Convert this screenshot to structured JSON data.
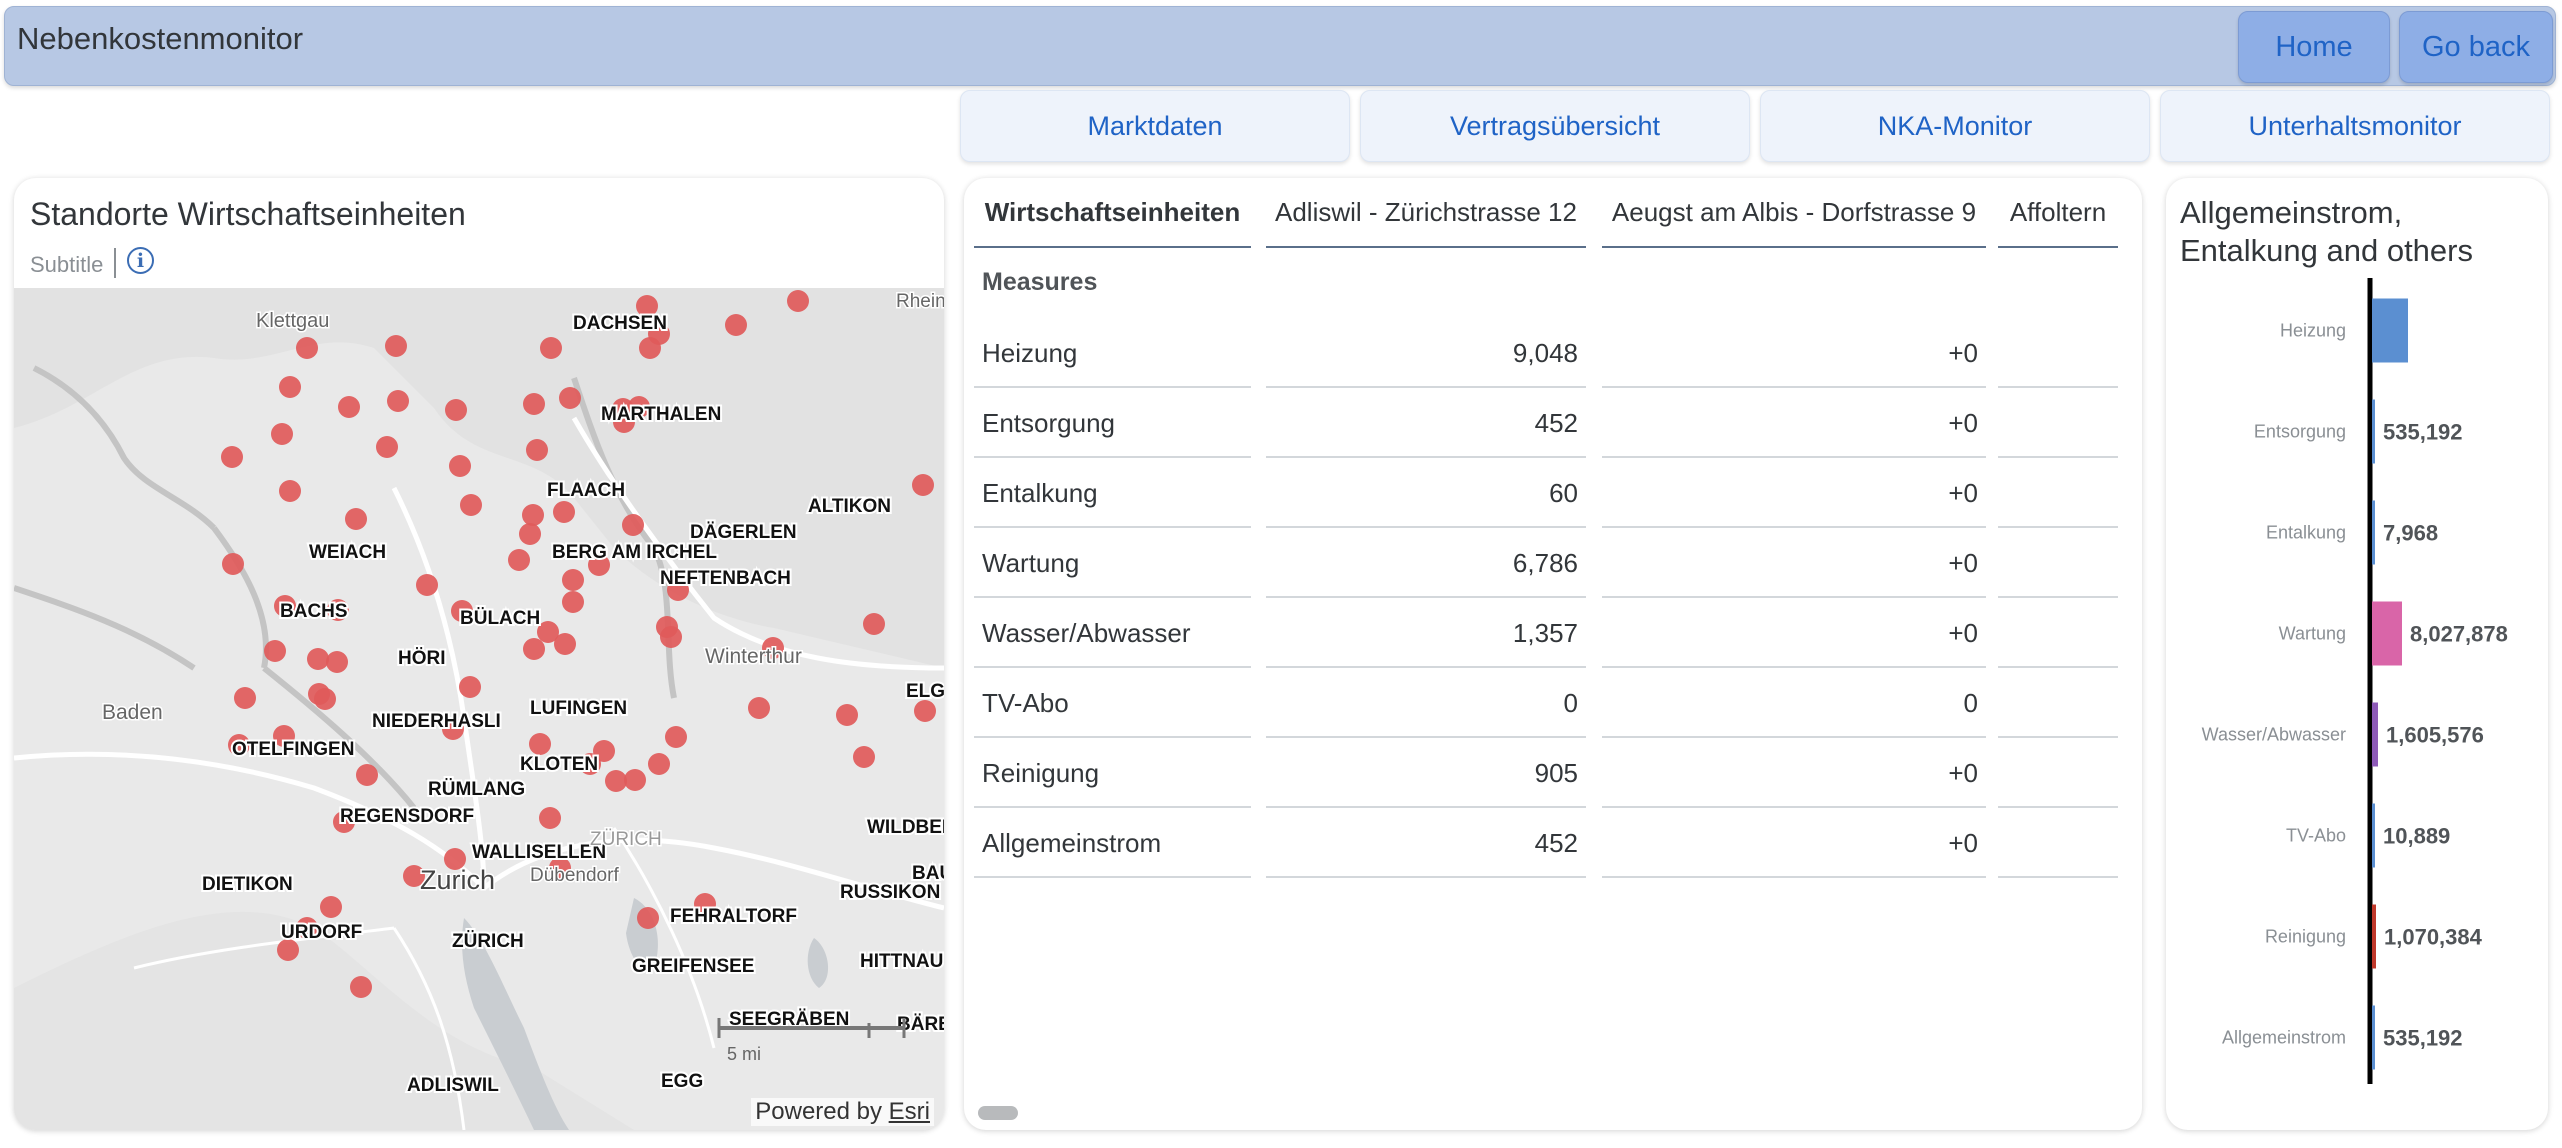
{
  "app": {
    "title": "Nebenkostenmonitor"
  },
  "header": {
    "home_label": "Home",
    "back_label": "Go back"
  },
  "nav": {
    "tabs": [
      "Marktdaten",
      "Vertragsübersicht",
      "NKA-Monitor",
      "Unterhaltsmonitor"
    ]
  },
  "map_card": {
    "title": "Standorte Wirtschaftseinheiten",
    "subtitle": "Subtitle",
    "info_icon": "info-icon",
    "attribution_prefix": "Powered by ",
    "attribution_link": "Esri",
    "scale_label": "5 mi",
    "marker_color": "#e05a5a",
    "place_labels": [
      "DACHSEN",
      "MARTHALEN",
      "FLAACH",
      "ALTIKON",
      "DÄGERLEN",
      "WEIACH",
      "BERG AM IRCHEL",
      "NEFTENBACH",
      "BACHS",
      "BÜLACH",
      "HÖRI",
      "LUFINGEN",
      "NIEDERHASLI",
      "OTELFINGEN",
      "KLOTEN",
      "RÜMLANG",
      "REGENSDORF",
      "WALLISELLEN",
      "DIETIKON",
      "URDORF",
      "ZÜRICH",
      "FEHRALTORF",
      "RUSSIKON",
      "WILDBERG",
      "HITTNAU",
      "GREIFENSEE",
      "SEEGRÄBEN",
      "ADLISWIL",
      "EGG",
      "ELG",
      "BAU",
      "BÄRE"
    ],
    "region_labels": [
      "Klettgau",
      "Rhein",
      "Winterthur",
      "Baden",
      "Zurich",
      "ZÜRICH",
      "Dübendorf"
    ]
  },
  "table": {
    "headers": [
      "Wirtschaftseinheiten",
      "Adliswil - Zürichstrasse 12",
      "Aeugst am Albis - Dorfstrasse 9",
      "Affoltern"
    ],
    "section_label": "Measures",
    "rows": [
      {
        "label": "Heizung",
        "v1": "9,048",
        "v2": "+0"
      },
      {
        "label": "Entsorgung",
        "v1": "452",
        "v2": "+0"
      },
      {
        "label": "Entalkung",
        "v1": "60",
        "v2": "+0"
      },
      {
        "label": "Wartung",
        "v1": "6,786",
        "v2": "+0"
      },
      {
        "label": "Wasser/Abwasser",
        "v1": "1,357",
        "v2": "+0"
      },
      {
        "label": "TV-Abo",
        "v1": "0",
        "v2": "0"
      },
      {
        "label": "Reinigung",
        "v1": "905",
        "v2": "+0"
      },
      {
        "label": "Allgemeinstrom",
        "v1": "452",
        "v2": "+0"
      }
    ]
  },
  "bar_card": {
    "title": "Allgemeinstrom, Entalkung and others"
  },
  "chart_data": {
    "type": "bar",
    "orientation": "horizontal",
    "title": "Allgemeinstrom, Entalkung and others",
    "categories": [
      "Heizung",
      "Entsorgung",
      "Entalkung",
      "Wartung",
      "Wasser/Abwasser",
      "TV-Abo",
      "Reinigung",
      "Allgemeinstrom"
    ],
    "values": [
      null,
      535192,
      7968,
      8027878,
      1605576,
      10889,
      1070384,
      535192
    ],
    "data_labels": [
      "",
      "535,192",
      "7,968",
      "8,027,878",
      "1,605,576",
      "10,889",
      "1,070,384",
      "535,192"
    ],
    "colors": [
      "#5b8fd1",
      "#5b8fd1",
      "#5b8fd1",
      "#d965a8",
      "#8e5bb8",
      "#5b8fd1",
      "#c0392b",
      "#5b8fd1"
    ],
    "grid": false,
    "legend": "none"
  }
}
